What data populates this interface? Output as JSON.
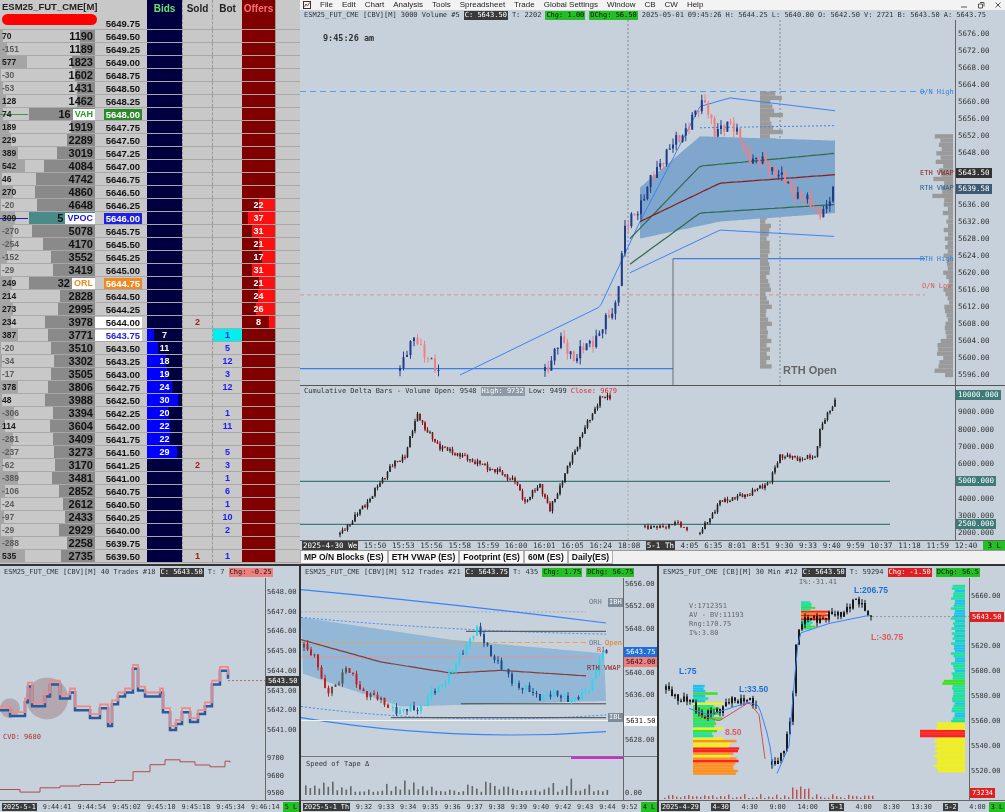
{
  "menu": {
    "items": [
      "File",
      "Edit",
      "Chart",
      "Analysis",
      "Tools",
      "Spreadsheet",
      "Trade",
      "Global Settings",
      "Window",
      "CB",
      "CW",
      "Help"
    ]
  },
  "dom": {
    "title": "ESM25_FUT_CME[M]",
    "columns": [
      "Bids",
      "Sold",
      "Bot",
      "Offers"
    ],
    "rows": [
      {
        "kind": "plain",
        "price": "5649.75"
      },
      {
        "kind": "plain",
        "delta": "70",
        "volume": "1190",
        "price": "5649.50"
      },
      {
        "kind": "plain",
        "delta": "-151",
        "volume": "1189",
        "price": "5649.25"
      },
      {
        "kind": "plain",
        "delta": "577",
        "volume": "1823",
        "price": "5649.00"
      },
      {
        "kind": "plain",
        "delta": "-30",
        "volume": "1602",
        "price": "5648.75"
      },
      {
        "kind": "plain",
        "delta": "-53",
        "volume": "1431",
        "price": "5648.50"
      },
      {
        "kind": "plain",
        "delta": "128",
        "volume": "1462",
        "price": "5648.25"
      },
      {
        "kind": "vah",
        "delta": "74",
        "volume": "16",
        "marker": "VAH",
        "price": "5648.00"
      },
      {
        "kind": "plain",
        "delta": "189",
        "volume": "1919",
        "price": "5647.75"
      },
      {
        "kind": "plain",
        "delta": "229",
        "volume": "2289",
        "price": "5647.50"
      },
      {
        "kind": "plain",
        "delta": "389",
        "volume": "3019",
        "price": "5647.25"
      },
      {
        "kind": "plain",
        "delta": "542",
        "volume": "4084",
        "price": "5647.00"
      },
      {
        "kind": "plain",
        "delta": "46",
        "volume": "4742",
        "price": "5646.75"
      },
      {
        "kind": "plain",
        "delta": "270",
        "volume": "4860",
        "price": "5646.50"
      },
      {
        "kind": "plain",
        "delta": "-20",
        "volume": "4648",
        "price": "5646.25",
        "offer": "22"
      },
      {
        "kind": "vpoc",
        "delta": "309",
        "volume": "5",
        "marker": "VPOC",
        "price": "5646.00",
        "offer": "37"
      },
      {
        "kind": "plain",
        "delta": "-270",
        "volume": "5078",
        "price": "5645.75",
        "offer": "31"
      },
      {
        "kind": "plain",
        "delta": "-254",
        "volume": "4170",
        "price": "5645.50",
        "offer": "21"
      },
      {
        "kind": "plain",
        "delta": "-152",
        "volume": "3552",
        "price": "5645.25",
        "offer": "17"
      },
      {
        "kind": "plain",
        "delta": "-29",
        "volume": "3419",
        "price": "5645.00",
        "offer": "31"
      },
      {
        "kind": "orl",
        "delta": "249",
        "volume": "32",
        "marker": "ORL",
        "price": "5644.75",
        "offer": "21"
      },
      {
        "kind": "plain",
        "delta": "214",
        "volume": "2828",
        "price": "5644.50",
        "offer": "24"
      },
      {
        "kind": "plain",
        "delta": "273",
        "volume": "2995",
        "price": "5644.25",
        "offer": "26"
      },
      {
        "kind": "inside",
        "delta": "234",
        "volume": "3978",
        "price": "5644.00",
        "sold": "2",
        "offer": "8"
      },
      {
        "kind": "last",
        "delta": "387",
        "volume": "3771",
        "price": "5643.75",
        "bid": "7",
        "bot": "1"
      },
      {
        "kind": "plain",
        "delta": "-20",
        "volume": "3510",
        "price": "5643.50",
        "bid": "11",
        "bot": "5"
      },
      {
        "kind": "plain",
        "delta": "-34",
        "volume": "3302",
        "price": "5643.25",
        "bid": "18",
        "bot": "12"
      },
      {
        "kind": "plain",
        "delta": "-17",
        "volume": "3505",
        "price": "5643.00",
        "bid": "19",
        "bot": "3"
      },
      {
        "kind": "plain",
        "delta": "378",
        "volume": "3806",
        "price": "5642.75",
        "bid": "24",
        "bot": "12"
      },
      {
        "kind": "plain",
        "delta": "48",
        "volume": "3988",
        "price": "5642.50",
        "bid": "30"
      },
      {
        "kind": "plain",
        "delta": "-306",
        "volume": "3394",
        "price": "5642.25",
        "bid": "20",
        "bot": "1"
      },
      {
        "kind": "plain",
        "delta": "114",
        "volume": "3604",
        "price": "5642.00",
        "bid": "22",
        "bot": "11"
      },
      {
        "kind": "plain",
        "delta": "-281",
        "volume": "3409",
        "price": "5641.75",
        "bid": "22"
      },
      {
        "kind": "plain",
        "delta": "-237",
        "volume": "3273",
        "price": "5641.50",
        "bid": "29",
        "bot": "5"
      },
      {
        "kind": "plain",
        "delta": "-62",
        "volume": "3170",
        "price": "5641.25",
        "sold": "2",
        "bot": "3"
      },
      {
        "kind": "plain",
        "delta": "-389",
        "volume": "3481",
        "price": "5641.00",
        "bot": "1"
      },
      {
        "kind": "plain",
        "delta": "-106",
        "volume": "2852",
        "price": "5640.75",
        "bot": "6"
      },
      {
        "kind": "plain",
        "delta": "-24",
        "volume": "2612",
        "price": "5640.50",
        "bot": "1"
      },
      {
        "kind": "plain",
        "delta": "-97",
        "volume": "2433",
        "price": "5640.25",
        "bot": "10"
      },
      {
        "kind": "plain",
        "delta": "-29",
        "volume": "2929",
        "price": "5640.00",
        "bot": "2"
      },
      {
        "kind": "plain",
        "delta": "-288",
        "volume": "2258",
        "price": "5639.75"
      },
      {
        "kind": "plain",
        "delta": "535",
        "volume": "2735",
        "price": "5639.50",
        "sold": "1",
        "bot": "1"
      }
    ]
  },
  "main_chart": {
    "header": [
      {
        "kind": "text",
        "text": "ESM25_FUT_CME [CBV][M]"
      },
      {
        "kind": "text",
        "text": "3000 Volume #5"
      },
      {
        "kind": "tag",
        "text": "C: 5643.50",
        "color": "#3a3a3a"
      },
      {
        "kind": "text",
        "text": "T: 2202"
      },
      {
        "kind": "tag",
        "text": "Chg: 1.00",
        "color": "#22c022"
      },
      {
        "kind": "tag",
        "text": "DChg: 56.50",
        "color": "#22c022"
      },
      {
        "kind": "text",
        "text": "2025-05-01"
      },
      {
        "kind": "text",
        "text": "09:45:26"
      },
      {
        "kind": "text",
        "text": "H: 5644.25"
      },
      {
        "kind": "text",
        "text": "L: 5640.00"
      },
      {
        "kind": "text",
        "text": "O: 5642.50"
      },
      {
        "kind": "text",
        "text": "V: 2721"
      },
      {
        "kind": "text",
        "text": "B: 5643.50"
      },
      {
        "kind": "text",
        "text": "A: 5643.75"
      }
    ],
    "clock": "9:45:26 am",
    "labels": [
      {
        "kind": "level",
        "text": "O/N High"
      },
      {
        "kind": "vwap",
        "text": "ETH VWAP"
      },
      {
        "kind": "rth",
        "text": "RTH VWAP"
      },
      {
        "kind": "level",
        "text": "RTH High"
      },
      {
        "kind": "low",
        "text": "O/N Low"
      },
      {
        "kind": "big",
        "text": "RTH Open"
      }
    ],
    "price_axis": [
      {
        "kind": "tick",
        "text": "5676.00"
      },
      {
        "kind": "tick",
        "text": "5672.00"
      },
      {
        "kind": "tick",
        "text": "5668.00"
      },
      {
        "kind": "tick",
        "text": "5664.00"
      },
      {
        "kind": "tick",
        "text": "5660.00"
      },
      {
        "kind": "tick",
        "text": "5656.00"
      },
      {
        "kind": "tick",
        "text": "5652.00"
      },
      {
        "kind": "tick",
        "text": "5648.00"
      },
      {
        "kind": "tag",
        "text": "5643.50",
        "color": "#333333"
      },
      {
        "kind": "tag",
        "text": "5639.58",
        "color": "#3d5a73"
      },
      {
        "kind": "tick",
        "text": "5636.00"
      },
      {
        "kind": "tick",
        "text": "5632.00"
      },
      {
        "kind": "tick",
        "text": "5628.00"
      },
      {
        "kind": "tick",
        "text": "5624.00"
      },
      {
        "kind": "tick",
        "text": "5620.00"
      },
      {
        "kind": "tick",
        "text": "5616.00"
      },
      {
        "kind": "tick",
        "text": "5612.00"
      },
      {
        "kind": "tick",
        "text": "5608.00"
      },
      {
        "kind": "tick",
        "text": "5604.00"
      },
      {
        "kind": "tick",
        "text": "5600.00"
      },
      {
        "kind": "tick",
        "text": "5596.00"
      }
    ],
    "delta_pane": {
      "header": [
        {
          "kind": "text",
          "text": "Cumulative Delta Bars - Volume"
        },
        {
          "kind": "text",
          "text": "Open: 9548"
        },
        {
          "kind": "light",
          "text": "High: 9732"
        },
        {
          "kind": "text",
          "text": "Low: 9499"
        },
        {
          "kind": "alert",
          "text": "Close: 9679"
        }
      ],
      "axis": [
        {
          "kind": "tag",
          "text": "10000.000",
          "color": "#3d7a78"
        },
        {
          "kind": "tick",
          "text": "9000.000"
        },
        {
          "kind": "tick",
          "text": "8000.000"
        },
        {
          "kind": "tick",
          "text": "7000.000"
        },
        {
          "kind": "tick",
          "text": "6000.000"
        },
        {
          "kind": "tag",
          "text": "5000.000",
          "color": "#3d7a78"
        },
        {
          "kind": "tick",
          "text": "4000.000"
        },
        {
          "kind": "tick",
          "text": "3000.000"
        },
        {
          "kind": "tag",
          "text": "2500.000",
          "color": "#3d7a78"
        },
        {
          "kind": "tick",
          "text": "2000.000"
        }
      ]
    },
    "time_axis": [
      {
        "kind": "tag",
        "text": "2025-4-30 We"
      },
      {
        "kind": "tick",
        "text": "15:50"
      },
      {
        "kind": "tick",
        "text": "15:53"
      },
      {
        "kind": "tick",
        "text": "15:56"
      },
      {
        "kind": "tick",
        "text": "15:58"
      },
      {
        "kind": "tick",
        "text": "15:59"
      },
      {
        "kind": "tick",
        "text": "16:00"
      },
      {
        "kind": "tick",
        "text": "16:01"
      },
      {
        "kind": "tick",
        "text": "16:05"
      },
      {
        "kind": "tick",
        "text": "16:24"
      },
      {
        "kind": "tick",
        "text": "18:08"
      },
      {
        "kind": "tag",
        "text": "5-1 Th"
      },
      {
        "kind": "tick",
        "text": "4:05"
      },
      {
        "kind": "tick",
        "text": "6:35"
      },
      {
        "kind": "tick",
        "text": "8:01"
      },
      {
        "kind": "tick",
        "text": "8:51"
      },
      {
        "kind": "tick",
        "text": "9:30"
      },
      {
        "kind": "tick",
        "text": "9:33"
      },
      {
        "kind": "tick",
        "text": "9:40"
      },
      {
        "kind": "tick",
        "text": "9:59"
      },
      {
        "kind": "tick",
        "text": "10:37"
      },
      {
        "kind": "tick",
        "text": "11:18"
      },
      {
        "kind": "tick",
        "text": "11:59"
      },
      {
        "kind": "tick",
        "text": "12:40"
      }
    ],
    "badge": "3 L"
  },
  "chart_tabs": [
    {
      "label": "MP O/N Blocks (ES)",
      "selected": false
    },
    {
      "label": "ETH VWAP (ES)",
      "selected": false
    },
    {
      "label": "Footprint (ES)",
      "selected": false
    },
    {
      "label": "60M (ES)",
      "selected": false
    },
    {
      "label": "Daily(ES)",
      "selected": false
    }
  ],
  "trades_chart": {
    "header": [
      {
        "kind": "text",
        "text": "ESM25_FUT_CME [CBV][M]"
      },
      {
        "kind": "text",
        "text": "40 Trades #18"
      },
      {
        "kind": "tag",
        "text": "C: 5643.50",
        "color": "#3a3a3a"
      },
      {
        "kind": "text",
        "text": "T: 7"
      },
      {
        "kind": "tag",
        "text": "Chg: -0.25",
        "color": "#f08080"
      }
    ],
    "labels": [
      {
        "kind": "cvd",
        "text": "CVD: 9680"
      }
    ],
    "price_axis": [
      {
        "kind": "tick",
        "text": "5648.00"
      },
      {
        "kind": "tick",
        "text": "5647.00"
      },
      {
        "kind": "tick",
        "text": "5646.00"
      },
      {
        "kind": "tick",
        "text": "5645.00"
      },
      {
        "kind": "tick",
        "text": "5644.00"
      },
      {
        "kind": "tag",
        "text": "5643.50",
        "color": "#3a3a3a"
      },
      {
        "kind": "tick",
        "text": "5643.00"
      },
      {
        "kind": "tick",
        "text": "5642.00"
      },
      {
        "kind": "tick",
        "text": "5641.00"
      }
    ],
    "cvd_axis": [
      {
        "kind": "tick",
        "text": "9700"
      },
      {
        "kind": "tick",
        "text": "9600"
      },
      {
        "kind": "tick",
        "text": "9500"
      }
    ],
    "time_axis": [
      {
        "kind": "tag",
        "text": "2025-5-1"
      },
      {
        "kind": "tick",
        "text": "9:44:41"
      },
      {
        "kind": "tick",
        "text": "9:44:54"
      },
      {
        "kind": "tick",
        "text": "9:45:02"
      },
      {
        "kind": "tick",
        "text": "9:45:10"
      },
      {
        "kind": "tick",
        "text": "9:45:18"
      },
      {
        "kind": "tick",
        "text": "9:45:34"
      },
      {
        "kind": "tick",
        "text": "9:46:14"
      }
    ],
    "badge": "5 L"
  },
  "tape_chart": {
    "header": [
      {
        "kind": "text",
        "text": "ESM25_FUT_CME [CBV][M]"
      },
      {
        "kind": "text",
        "text": "512 Trades #21"
      },
      {
        "kind": "tag",
        "text": "C: 5643.75",
        "color": "#3a3a3a"
      },
      {
        "kind": "text",
        "text": "T: 435"
      },
      {
        "kind": "tag",
        "text": "Chg: 1.75",
        "color": "#22c022"
      },
      {
        "kind": "tag",
        "text": "DChg: 56.75",
        "color": "#22c022"
      }
    ],
    "labels": [
      {
        "kind": "faint",
        "text": "ORH"
      },
      {
        "kind": "ib",
        "text": "IBH"
      },
      {
        "kind": "faint",
        "text": "ORL"
      },
      {
        "kind": "open",
        "text": "Open"
      },
      {
        "kind": "low",
        "text": "R1"
      },
      {
        "kind": "vwap",
        "text": "RTH VWAP"
      },
      {
        "kind": "ib",
        "text": "IBL"
      }
    ],
    "price_axis": [
      {
        "kind": "tick",
        "text": "5656.00"
      },
      {
        "kind": "tick",
        "text": "5652.00"
      },
      {
        "kind": "tick",
        "text": "5648.00"
      },
      {
        "kind": "tag",
        "text": "5643.75",
        "color": "#1e6fd9"
      },
      {
        "kind": "tag",
        "text": "5642.00",
        "color": "#f08080"
      },
      {
        "kind": "tick",
        "text": "5640.00"
      },
      {
        "kind": "tick",
        "text": "5636.00"
      },
      {
        "kind": "tag",
        "text": "5631.50",
        "color": "#ffffff"
      },
      {
        "kind": "tick",
        "text": "5628.00"
      }
    ],
    "tape_pane": {
      "title": "Speed of Tape Δ",
      "axis": [
        {
          "kind": "tick",
          "text": "0.00"
        }
      ]
    },
    "time_axis": [
      {
        "kind": "tag",
        "text": "2025-5-1 Th"
      },
      {
        "kind": "tick",
        "text": "9:32"
      },
      {
        "kind": "tick",
        "text": "9:33"
      },
      {
        "kind": "tick",
        "text": "9:34"
      },
      {
        "kind": "tick",
        "text": "9:35"
      },
      {
        "kind": "tick",
        "text": "9:36"
      },
      {
        "kind": "tick",
        "text": "9:37"
      },
      {
        "kind": "tick",
        "text": "9:38"
      },
      {
        "kind": "tick",
        "text": "9:39"
      },
      {
        "kind": "tick",
        "text": "9:40"
      },
      {
        "kind": "tick",
        "text": "9:42"
      },
      {
        "kind": "tick",
        "text": "9:43"
      },
      {
        "kind": "tick",
        "text": "9:44"
      },
      {
        "kind": "tick",
        "text": "9:52"
      }
    ],
    "badge": "4 L"
  },
  "profile_chart": {
    "header": [
      {
        "kind": "text",
        "text": "ESM25_FUT_CME [CB][M]"
      },
      {
        "kind": "text",
        "text": "30 Min #12"
      },
      {
        "kind": "tag",
        "text": "C: 5643.50",
        "color": "#3a3a3a"
      },
      {
        "kind": "text",
        "text": "T: 59294"
      },
      {
        "kind": "tag",
        "text": "Chg: -1.50",
        "color": "#e02020"
      },
      {
        "kind": "tag",
        "text": "DChg: 56.5",
        "color": "#22c022"
      }
    ],
    "labels": [
      {
        "kind": "info",
        "text": "I%:-31.41"
      },
      {
        "kind": "info",
        "text": "V:1712351"
      },
      {
        "kind": "info",
        "text": "AV - BV:11193"
      },
      {
        "kind": "info",
        "text": "Rng:170.75"
      },
      {
        "kind": "info",
        "text": "I%:3.80"
      },
      {
        "kind": "up",
        "text": "L:206.75"
      },
      {
        "kind": "down",
        "text": "L:-30.75"
      },
      {
        "kind": "up",
        "text": "L:75"
      },
      {
        "kind": "up",
        "text": "L:33.50"
      },
      {
        "kind": "down",
        "text": "8.50"
      }
    ],
    "price_axis": [
      {
        "kind": "tick",
        "text": "5660.00"
      },
      {
        "kind": "tag",
        "text": "5643.50",
        "color": "#e02020"
      },
      {
        "kind": "tick",
        "text": "5620.00"
      },
      {
        "kind": "tick",
        "text": "5600.00"
      },
      {
        "kind": "tick",
        "text": "5580.00"
      },
      {
        "kind": "tick",
        "text": "5560.00"
      },
      {
        "kind": "tick",
        "text": "5540.00"
      },
      {
        "kind": "tick",
        "text": "5520.00"
      }
    ],
    "volume_axis": [
      {
        "kind": "tag",
        "text": "73234",
        "color": "#e02020"
      }
    ],
    "time_axis": [
      {
        "kind": "tag",
        "text": "2025-4-29"
      },
      {
        "kind": "tag",
        "text": "4-30"
      },
      {
        "kind": "tick",
        "text": "4:30"
      },
      {
        "kind": "tick",
        "text": "9:00"
      },
      {
        "kind": "tick",
        "text": "14:00"
      },
      {
        "kind": "tag",
        "text": "5-1"
      },
      {
        "kind": "tick",
        "text": "4:00"
      },
      {
        "kind": "tick",
        "text": "8:30"
      },
      {
        "kind": "tick",
        "text": "13:30"
      },
      {
        "kind": "tag",
        "text": "5-2"
      },
      {
        "kind": "tick",
        "text": "4:00"
      }
    ],
    "badge": "3 L"
  }
}
